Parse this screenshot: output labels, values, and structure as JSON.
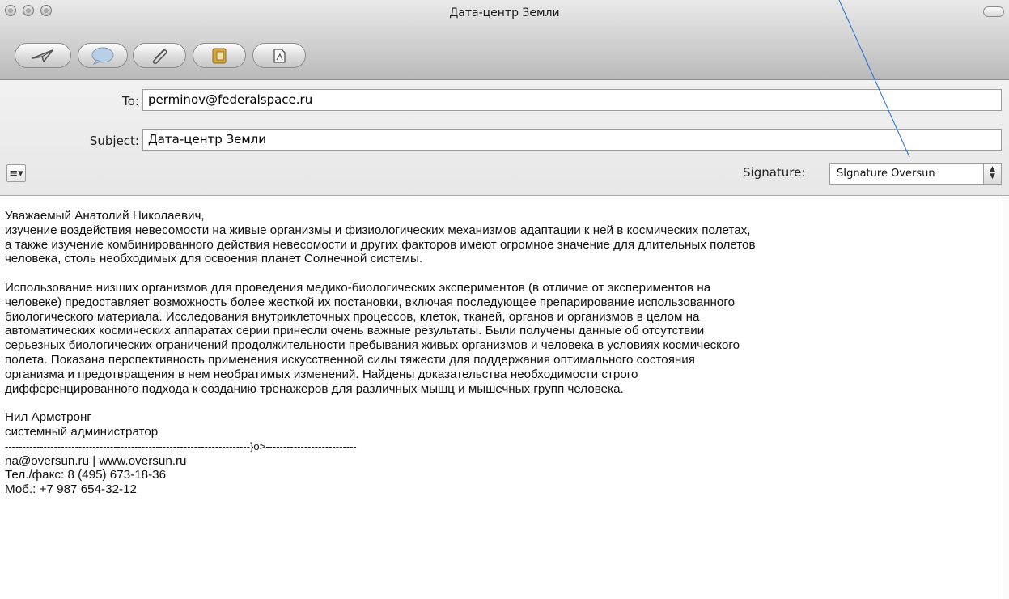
{
  "window": {
    "title": "Дата-центр Земли"
  },
  "toolbar": {
    "buttons": [
      {
        "name": "send",
        "icon": "send-icon"
      },
      {
        "name": "chat",
        "icon": "chat-bubble-icon"
      },
      {
        "name": "attach",
        "icon": "paperclip-icon"
      },
      {
        "name": "address",
        "icon": "address-book-icon"
      },
      {
        "name": "photo",
        "icon": "photo-browser-icon"
      }
    ]
  },
  "headers": {
    "to_label": "To:",
    "to_value": "perminov@federalspace.ru",
    "subject_label": "Subject:",
    "subject_value": "Дата-центр Земли",
    "format_menu": "≡▾",
    "signature_label": "Signature:",
    "signature_value": "SIgnature Oversun"
  },
  "body": {
    "greeting": "Уважаемый Анатолий Николаевич,",
    "paragraph1": "изучение воздействия невесомости на живые организмы и физиологических механизмов адаптации к ней в космических полетах,\nа также изучение комбинированного действия невесомости и других факторов имеют огромное значение для длительных полетов\nчеловека, столь необходимых для освоения планет Солнечной системы.",
    "paragraph2": "Использование низших организмов для проведения медико-биологических экспериментов (в отличие от экспериментов на\nчеловеке) предоставляет возможность более жесткой их постановки, включая последующее препарирование использованного\nбиологического материала. Исследования внутриклеточных процессов, клеток, тканей, органов и организмов в целом на\nавтоматических космических аппаратах серии принесли очень важные результаты. Были получены данные об отсутствии\nсерьезных биологических ограничений продолжительности пребывания живых организмов и человека в условиях космического\nполета. Показана перспективность применения искусственной силы тяжести для поддержания оптимального состояния\nорганизма и предотвращения в нем необратимых изменений. Найдены доказательства необходимости строго\nдифференцированного подхода к созданию тренажеров для различных мышц и мышечных групп человека.",
    "sender_name": "Нил Армстронг",
    "sender_role": "системный администратор",
    "divider": "----------------------------------------------------------------------}o>--------------------------",
    "contacts": "na@oversun.ru | www.oversun.ru",
    "phone": "Тел./факс: 8 (495) 673-18-36",
    "mobile": "Моб.: +7 987 654-32-12"
  },
  "colors": {
    "pointer_line": "#1f6fd6"
  }
}
